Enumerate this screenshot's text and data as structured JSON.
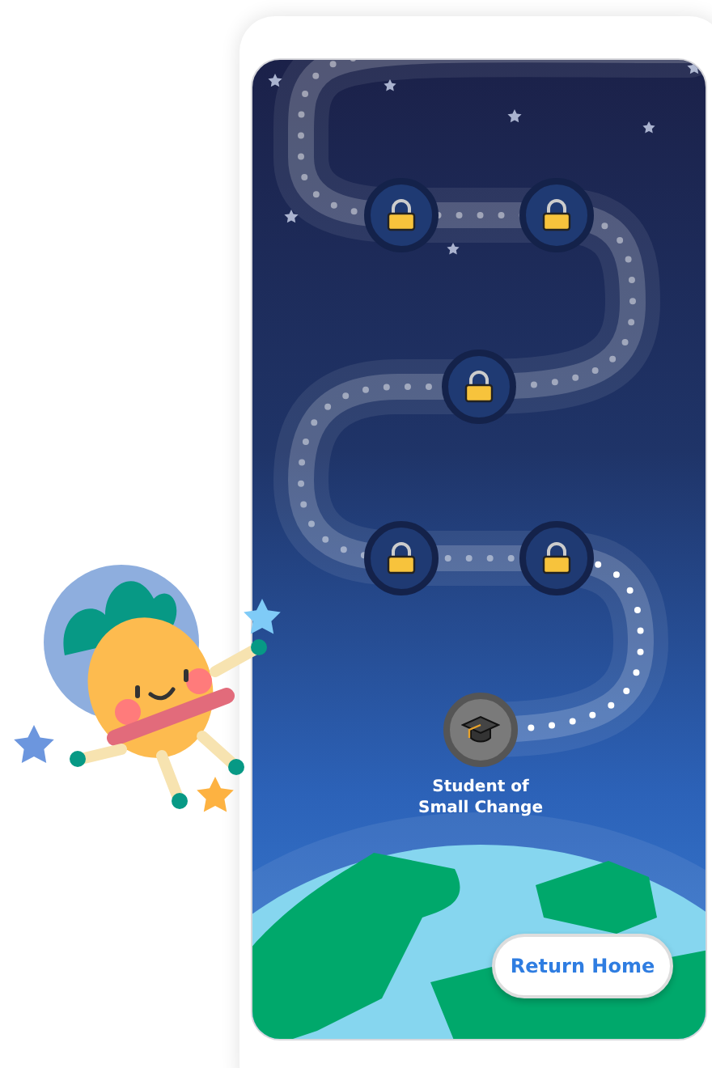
{
  "map": {
    "nodes": [
      {
        "kind": "level",
        "locked": true
      },
      {
        "kind": "level",
        "locked": true
      },
      {
        "kind": "level",
        "locked": true
      },
      {
        "kind": "level",
        "locked": true
      },
      {
        "kind": "level",
        "locked": true
      },
      {
        "kind": "badge",
        "locked": false,
        "label": "Student of Small Change"
      }
    ]
  },
  "return_button": {
    "label": "Return Home"
  }
}
